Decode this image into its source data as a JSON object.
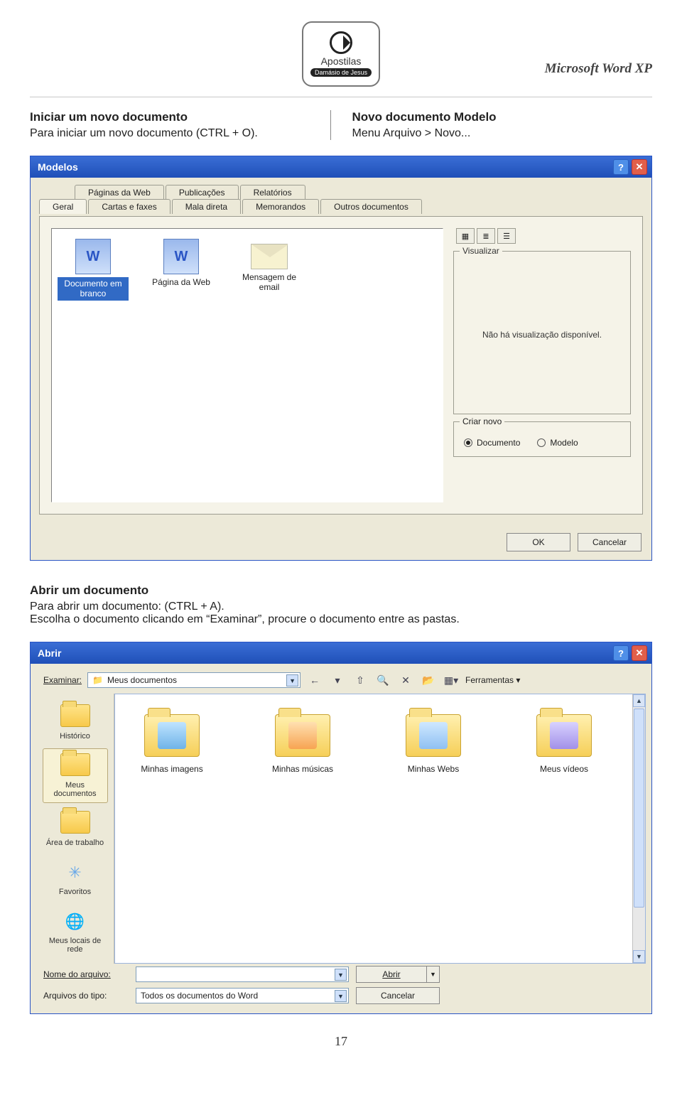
{
  "header": {
    "logo_line1": "Apostilas",
    "logo_line2": "Damásio de Jesus",
    "doc_title": "Microsoft Word XP"
  },
  "intro": {
    "left_heading": "Iniciar um novo documento",
    "left_text": "Para iniciar um novo documento (CTRL + O).",
    "right_heading": "Novo documento Modelo",
    "right_text": "Menu Arquivo > Novo..."
  },
  "modelos": {
    "title": "Modelos",
    "tabs_back": [
      "Páginas da Web",
      "Publicações",
      "Relatórios"
    ],
    "tabs_front": [
      "Geral",
      "Cartas e faxes",
      "Mala direta",
      "Memorandos",
      "Outros documentos"
    ],
    "active_tab": "Geral",
    "templates": [
      {
        "label": "Documento em branco",
        "selected": true,
        "icon": "doc"
      },
      {
        "label": "Página da Web",
        "selected": false,
        "icon": "doc"
      },
      {
        "label": "Mensagem de email",
        "selected": false,
        "icon": "mail"
      }
    ],
    "visualizar_legend": "Visualizar",
    "visualizar_text": "Não há visualização disponível.",
    "criar_legend": "Criar novo",
    "radio_documento": "Documento",
    "radio_modelo": "Modelo",
    "ok": "OK",
    "cancelar": "Cancelar"
  },
  "mid_section": {
    "heading": "Abrir um documento",
    "line1": "Para abrir um documento: (CTRL + A).",
    "line2": "Escolha o documento clicando em “Examinar”, procure o documento entre as pastas."
  },
  "abrir": {
    "title": "Abrir",
    "examinar_label": "Examinar:",
    "examinar_value": "Meus documentos",
    "ferramentas": "Ferramentas",
    "places": [
      {
        "label": "Histórico",
        "selected": false
      },
      {
        "label": "Meus documentos",
        "selected": true
      },
      {
        "label": "Área de trabalho",
        "selected": false
      },
      {
        "label": "Favoritos",
        "selected": false
      },
      {
        "label": "Meus locais de rede",
        "selected": false
      }
    ],
    "folders": [
      {
        "label": "Minhas imagens",
        "variant": "img"
      },
      {
        "label": "Minhas músicas",
        "variant": "music"
      },
      {
        "label": "Minhas Webs",
        "variant": "web"
      },
      {
        "label": "Meus vídeos",
        "variant": "video"
      }
    ],
    "nome_label": "Nome do arquivo:",
    "nome_value": "",
    "tipo_label": "Arquivos do tipo:",
    "tipo_value": "Todos os documentos do Word",
    "abrir_btn": "Abrir",
    "cancelar_btn": "Cancelar"
  },
  "page_number": "17"
}
